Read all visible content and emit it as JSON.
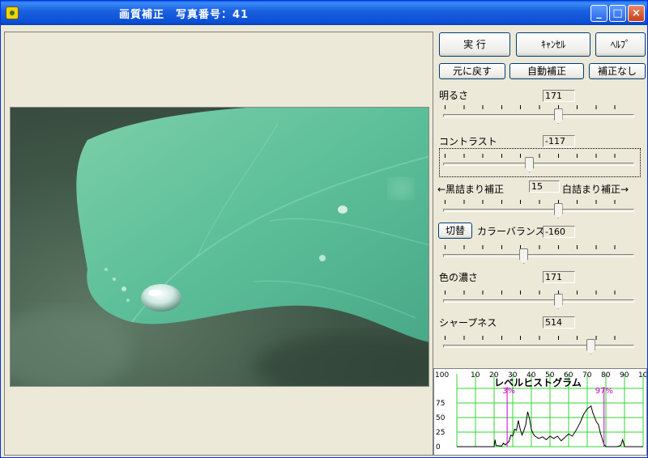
{
  "window": {
    "title": "画質補正　写真番号：41",
    "controls": {
      "minimize": "_",
      "maximize": "□",
      "close": "×"
    }
  },
  "buttons": {
    "execute": "実 行",
    "cancel": "ｷｬﾝｾﾙ",
    "help": "ﾍﾙﾌﾟ",
    "undo": "元に戻す",
    "auto_correct": "自動補正",
    "no_correct": "補正なし"
  },
  "adjustments": {
    "brightness": {
      "label": "明るさ",
      "value": "171",
      "position": 0.6
    },
    "contrast": {
      "label": "コントラスト",
      "value": "-117",
      "position": 0.45
    },
    "levels": {
      "label_left": "←黒詰まり補正",
      "label_right": "白詰まり補正→",
      "value": "15",
      "position": 0.6
    },
    "color_balance": {
      "toggle_label": "切替",
      "label": "カラーバランス",
      "value": "-160",
      "position": 0.42
    },
    "saturation": {
      "label": "色の濃さ",
      "value": "171",
      "position": 0.6
    },
    "sharpness": {
      "label": "シャープネス",
      "value": "514",
      "position": 0.77
    }
  },
  "histogram": {
    "title": "レベルヒストグラム",
    "x_ticks": [
      "100",
      "10",
      "20",
      "30",
      "40",
      "50",
      "60",
      "70",
      "80",
      "90",
      "100"
    ],
    "y_ticks": [
      "100",
      "75",
      "50",
      "25",
      "0"
    ],
    "black_marker": {
      "label": "3%",
      "at": 27
    },
    "white_marker": {
      "label": "97%",
      "at": 79
    },
    "colors": {
      "grid": "#33d633",
      "marker": "#cc00cc",
      "curve": "#000000"
    }
  }
}
